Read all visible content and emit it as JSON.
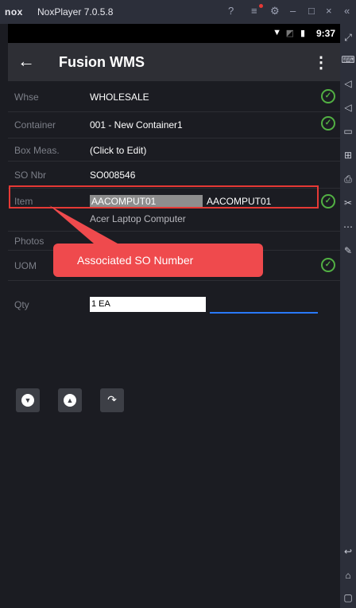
{
  "emulator": {
    "logo": "nox",
    "title": "NoxPlayer 7.0.5.8",
    "controls": [
      "?",
      "≡",
      "⚙",
      "–",
      "□",
      "×",
      "«"
    ]
  },
  "status_bar": {
    "time": "9:37"
  },
  "app_bar": {
    "title": "Fusion WMS"
  },
  "fields": {
    "whse": {
      "label": "Whse",
      "value": "WHOLESALE"
    },
    "container": {
      "label": "Container",
      "value": "001 - New Container1"
    },
    "box_meas": {
      "label": "Box Meas.",
      "value": "(Click to Edit)"
    },
    "so_nbr": {
      "label": "SO Nbr",
      "value": "SO008546"
    },
    "item": {
      "label": "Item",
      "value": "AACOMPUT01",
      "value2": "AACOMPUT01",
      "description": "Acer Laptop Computer"
    },
    "photos": {
      "label": "Photos"
    },
    "uom": {
      "label": "UOM"
    },
    "qty": {
      "label": "Qty",
      "value": "1 EA"
    }
  },
  "annotation": {
    "callout_text": "Associated SO Number",
    "color": "#e53935"
  },
  "colors": {
    "check_green": "#52b043",
    "accent_blue": "#2979ff"
  },
  "toolbar_icons": [
    "expand-icon",
    "keyboard-icon",
    "volume-up-icon",
    "volume-down-icon",
    "screen-icon",
    "add-apk-icon",
    "printer-icon",
    "scissors-icon",
    "more-icon",
    "edit-icon",
    "back-icon",
    "home-icon",
    "recent-apps-icon"
  ]
}
